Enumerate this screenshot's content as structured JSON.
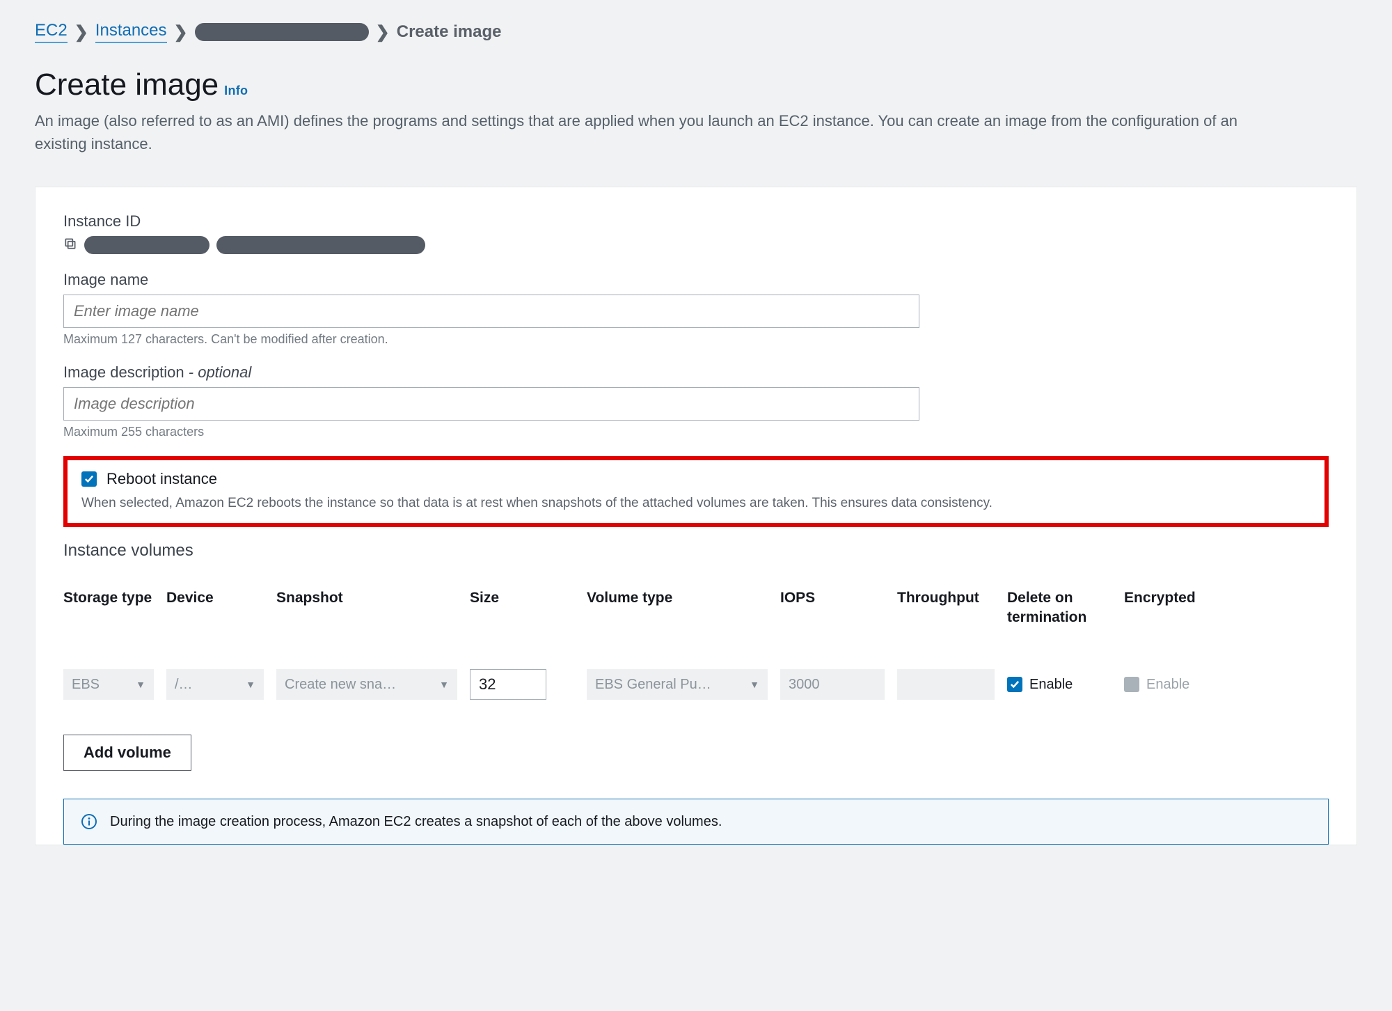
{
  "breadcrumbs": {
    "ec2": "EC2",
    "instances": "Instances",
    "current": "Create image"
  },
  "header": {
    "title": "Create image",
    "info_link": "Info",
    "description": "An image (also referred to as an AMI) defines the programs and settings that are applied when you launch an EC2 instance. You can create an image from the configuration of an existing instance."
  },
  "instance_id": {
    "label": "Instance ID"
  },
  "image_name": {
    "label": "Image name",
    "placeholder": "Enter image name",
    "hint": "Maximum 127 characters. Can't be modified after creation."
  },
  "image_desc": {
    "label_main": "Image description",
    "label_suffix": " - optional",
    "placeholder": "Image description",
    "hint": "Maximum 255 characters"
  },
  "reboot": {
    "label": "Reboot instance",
    "description": "When selected, Amazon EC2 reboots the instance so that data is at rest when snapshots of the attached volumes are taken. This ensures data consistency.",
    "checked": true
  },
  "volumes": {
    "section_title": "Instance volumes",
    "headers": {
      "storage_type": "Storage type",
      "device": "Device",
      "snapshot": "Snapshot",
      "size": "Size",
      "volume_type": "Volume type",
      "iops": "IOPS",
      "throughput": "Throughput",
      "delete_on_termination": "Delete on termination",
      "encrypted": "Encrypted"
    },
    "row": {
      "storage_type": "EBS",
      "device": "/…",
      "snapshot": "Create new sna…",
      "size": "32",
      "volume_type": "EBS General Pu…",
      "iops": "3000",
      "throughput": "",
      "delete_on_termination_label": "Enable",
      "delete_on_termination_checked": true,
      "encrypted_label": "Enable",
      "encrypted_checked": false
    },
    "add_button": "Add volume"
  },
  "info_banner": {
    "text": "During the image creation process, Amazon EC2 creates a snapshot of each of the above volumes."
  }
}
